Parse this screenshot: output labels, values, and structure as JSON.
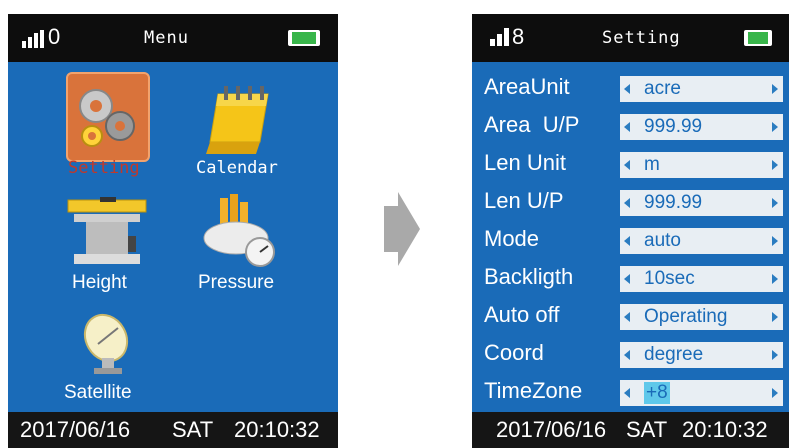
{
  "left_screen": {
    "signal_count": "0",
    "title": "Menu",
    "menu_items": [
      {
        "label": "Setting",
        "icon": "gears-icon"
      },
      {
        "label": "Calendar",
        "icon": "calendar-icon"
      },
      {
        "label": "Height",
        "icon": "height-gauge-icon"
      },
      {
        "label": "Pressure",
        "icon": "pressure-gauge-icon"
      },
      {
        "label": "Satellite",
        "icon": "satellite-dish-icon"
      }
    ],
    "status": {
      "date": "2017/06/16",
      "day": "SAT",
      "time": "20:10:32"
    }
  },
  "right_screen": {
    "signal_count": "8",
    "title": "Setting",
    "rows": [
      {
        "label": "AreaUnit",
        "value": "acre"
      },
      {
        "label": "Area  U/P",
        "value": "999.99"
      },
      {
        "label": "Len Unit",
        "value": "m"
      },
      {
        "label": "Len U/P",
        "value": "999.99"
      },
      {
        "label": "Mode",
        "value": "auto"
      },
      {
        "label": "Backligth",
        "value": "10sec"
      },
      {
        "label": "Auto off",
        "value": "Operating"
      },
      {
        "label": "Coord",
        "value": "degree"
      },
      {
        "label": "TimeZone",
        "value": "+8"
      }
    ],
    "status": {
      "date": "2017/06/16",
      "day": "SAT",
      "time": "20:10:32"
    }
  },
  "colors": {
    "screen_bg": "#1a6bb8",
    "bar_bg": "#0d0d0d",
    "selected_label": "#c0392b",
    "field_bg": "#e8eef3",
    "highlight": "#5fc8ea",
    "battery": "#38b54a",
    "arrow": "#a9a9a9"
  }
}
